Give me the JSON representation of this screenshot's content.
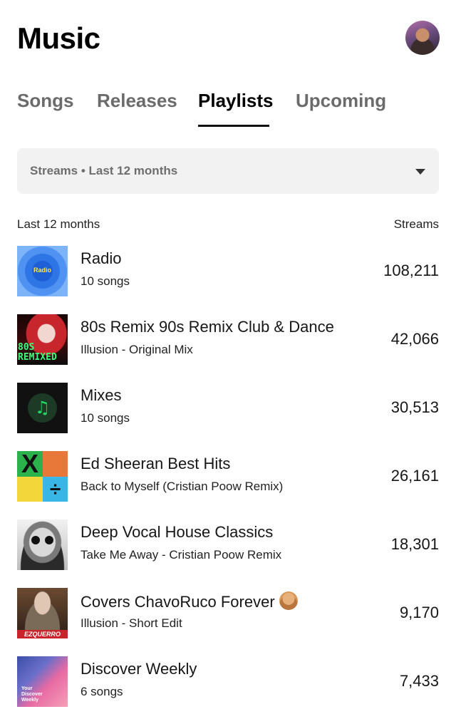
{
  "header": {
    "title": "Music"
  },
  "tabs": [
    {
      "label": "Songs",
      "active": false
    },
    {
      "label": "Releases",
      "active": false
    },
    {
      "label": "Playlists",
      "active": true
    },
    {
      "label": "Upcoming",
      "active": false
    }
  ],
  "filter": {
    "label": "Streams • Last 12 months",
    "icon": "caret-down-icon"
  },
  "list_header": {
    "left": "Last 12 months",
    "right": "Streams"
  },
  "playlists": [
    {
      "name": "Radio",
      "subtitle": "10 songs",
      "streams": "108,211",
      "cover_text": "Radio"
    },
    {
      "name": "80s Remix 90s Remix Club & Dance",
      "subtitle": "Illusion - Original Mix",
      "streams": "42,066",
      "cover_text": "80S REMIXED"
    },
    {
      "name": "Mixes",
      "subtitle": "10 songs",
      "streams": "30,513",
      "cover_text": ""
    },
    {
      "name": "Ed Sheeran Best Hits",
      "subtitle": "Back to Myself (Cristian Poow Remix)",
      "streams": "26,161",
      "cover_text": ""
    },
    {
      "name": "Deep Vocal House Classics",
      "subtitle": "Take Me Away - Cristian Poow Remix",
      "streams": "18,301",
      "cover_text": ""
    },
    {
      "name": "Covers ChavoRuco Forever",
      "subtitle": "Illusion - Short Edit",
      "streams": "9,170",
      "cover_text": "EZQUERRO"
    },
    {
      "name": "Discover Weekly",
      "subtitle": "6 songs",
      "streams": "7,433",
      "cover_text": "Your Discover Weekly"
    }
  ]
}
